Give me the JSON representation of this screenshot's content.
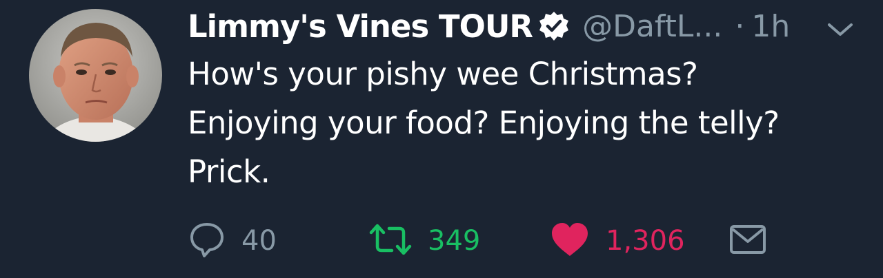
{
  "tweet": {
    "display_name": "Limmy's Vines TOUR",
    "handle": "@DaftL...",
    "separator": "·",
    "time": "1h",
    "body_lines": [
      "How's your pishy wee Christmas?",
      "Enjoying your food? Enjoying the telly?",
      "Prick."
    ]
  },
  "actions": {
    "reply_count": "40",
    "retweet_count": "349",
    "like_count": "1,306"
  },
  "icons": {
    "verified": "verified-badge-icon",
    "caret": "chevron-down-icon",
    "reply": "reply-bubble-icon",
    "retweet": "retweet-icon",
    "like": "heart-icon",
    "dm": "envelope-icon"
  },
  "colors": {
    "background": "#1b2432",
    "muted": "#8899a6",
    "retweet": "#19bf63",
    "like": "#e0245e"
  }
}
